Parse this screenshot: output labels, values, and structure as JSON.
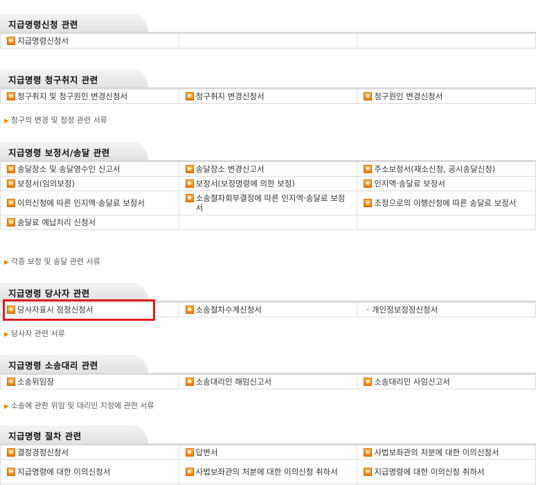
{
  "sections": [
    {
      "title": "지급명령신청 관련",
      "rows": [
        [
          "지급명령신청서",
          "",
          ""
        ]
      ]
    },
    {
      "title": "지급명령 청구취지 관련",
      "rows": [
        [
          "청구취지 및 청구원인 변경신청서",
          "청구취지 변경신청서",
          "청구원인 변경신청서"
        ]
      ],
      "note": "청구의 변경 및 정정 관련 서류"
    },
    {
      "title": "지급명령 보정서/송달 관련",
      "rows": [
        [
          "송달장소 및 송달영수인 신고서",
          "송달장소 변경신고서",
          "주소보정서(재소신청, 공시송달신청)"
        ],
        [
          "보정서(임의보정)",
          "보정서(보정명령에 의한 보정)",
          "인지액·송달료 보정서"
        ],
        [
          "이의신청에 따른 인지액·송달료 보정서",
          "소송절차회부결정에 따른 인지액·송달료 보정서",
          "조정으로의 이행신청에 따른 송달료 보정서"
        ],
        [
          "송달료 예납처리 신청서",
          "",
          ""
        ]
      ],
      "note": "각종 보정 및 송달 관련 서류"
    },
    {
      "title": "지급명령 당사자 관련",
      "rows": [
        [
          "당사자표시 정정신청서",
          "소송절차수계신청서",
          "개인정보정정신청서"
        ]
      ],
      "note": "당사자 관련 서류"
    },
    {
      "title": "지급명령 소송대리 관련",
      "rows": [
        [
          "소송위임장",
          "소송대리인 해임신고서",
          "소송대리인 사임신고서"
        ]
      ],
      "note": "소송에 관한 위임 및 대리인 지정에 관한 서류"
    },
    {
      "title": "지급명령 절차 관련",
      "rows": [
        [
          "결정경정신청서",
          "답변서",
          "사법보좌관의 처분에 대한 이의신청서"
        ],
        [
          "지급명령에 대한 이의신청서",
          "사법보좌관의 처분에 대한 이의신청 취하서",
          "지급명령에 대한 이의신청 취하서"
        ]
      ]
    }
  ],
  "icon": "e-document-icon",
  "colors": {
    "accent": "#f08c00",
    "highlight": "#e31b1b"
  }
}
